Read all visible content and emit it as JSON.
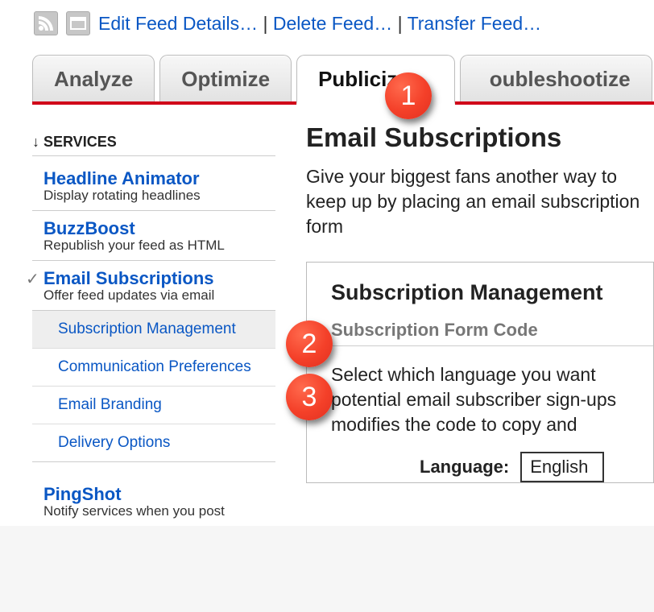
{
  "toolbar": {
    "edit": "Edit Feed Details…",
    "del": "Delete Feed…",
    "transfer": "Transfer Feed…"
  },
  "tabs": {
    "analyze": "Analyze",
    "optimize": "Optimize",
    "publicize": "Publicize",
    "trouble": "oubleshootize"
  },
  "services_header": "↓ SERVICES",
  "services": {
    "headline": {
      "title": "Headline Animator",
      "desc": "Display rotating headlines"
    },
    "buzz": {
      "title": "BuzzBoost",
      "desc": "Republish your feed as HTML"
    },
    "email": {
      "title": "Email Subscriptions",
      "desc": "Offer feed updates via email"
    },
    "ping": {
      "title": "PingShot",
      "desc": "Notify services when you post"
    }
  },
  "subnav": {
    "mgmt": "Subscription Management",
    "comm": "Communication Preferences",
    "brand": "Email Branding",
    "deliv": "Delivery Options"
  },
  "main": {
    "title": "Email Subscriptions",
    "intro": "Give your biggest fans another way to keep up by placing an email subscription form",
    "panel_title": "Subscription Management",
    "section_title": "Subscription Form Code",
    "section_body": "Select which language you want potential email subscriber sign-ups modifies the code to copy and",
    "lang_label": "Language:",
    "lang_value": "English"
  },
  "badges": {
    "b1": "1",
    "b2": "2",
    "b3": "3"
  }
}
